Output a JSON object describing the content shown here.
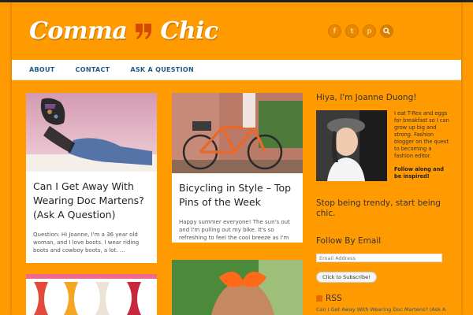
{
  "site": {
    "logo_left": "Comma",
    "logo_right": "Chic",
    "social_icons": [
      "facebook-icon",
      "twitter-icon",
      "pinterest-icon",
      "search-icon"
    ]
  },
  "nav": {
    "items": [
      "ABOUT",
      "CONTACT",
      "ASK A QUESTION"
    ]
  },
  "posts": [
    {
      "title": "Can I Get Away With Wearing Doc Martens? (Ask A Question)",
      "excerpt": "Question: Hi Joanne, I'm a 36 year old woman, and I love boots. I wear riding boots and cowboy boots, a lot. …"
    },
    {
      "title": "Bicycling in Style – Top Pins of the Week",
      "excerpt": "Happy summer everyone! The sun's out and I'm pulling out my bike. It's so refreshing to feel the cool breeze as I'm …"
    }
  ],
  "sidebar": {
    "about_heading": "Hiya, I'm Joanne Duong!",
    "about_text": "I eat T-Rex and eggs for breakfast so I can grow up big and strong. Fashion blogger on the quest to becoming a fashion editor.",
    "about_cta": "Follow along and be inspired!",
    "tagline": "Stop being trendy, start being chic.",
    "follow_heading": "Follow By Email",
    "email_placeholder": "Email Address",
    "subscribe_label": "Click to Subscribe!",
    "rss_label": "RSS",
    "rss_link": "Can I Get Away With Wearing Doc Martens? (Ask A"
  },
  "colors": {
    "background": "#ff9a00",
    "nav_link": "#1e5a82"
  }
}
